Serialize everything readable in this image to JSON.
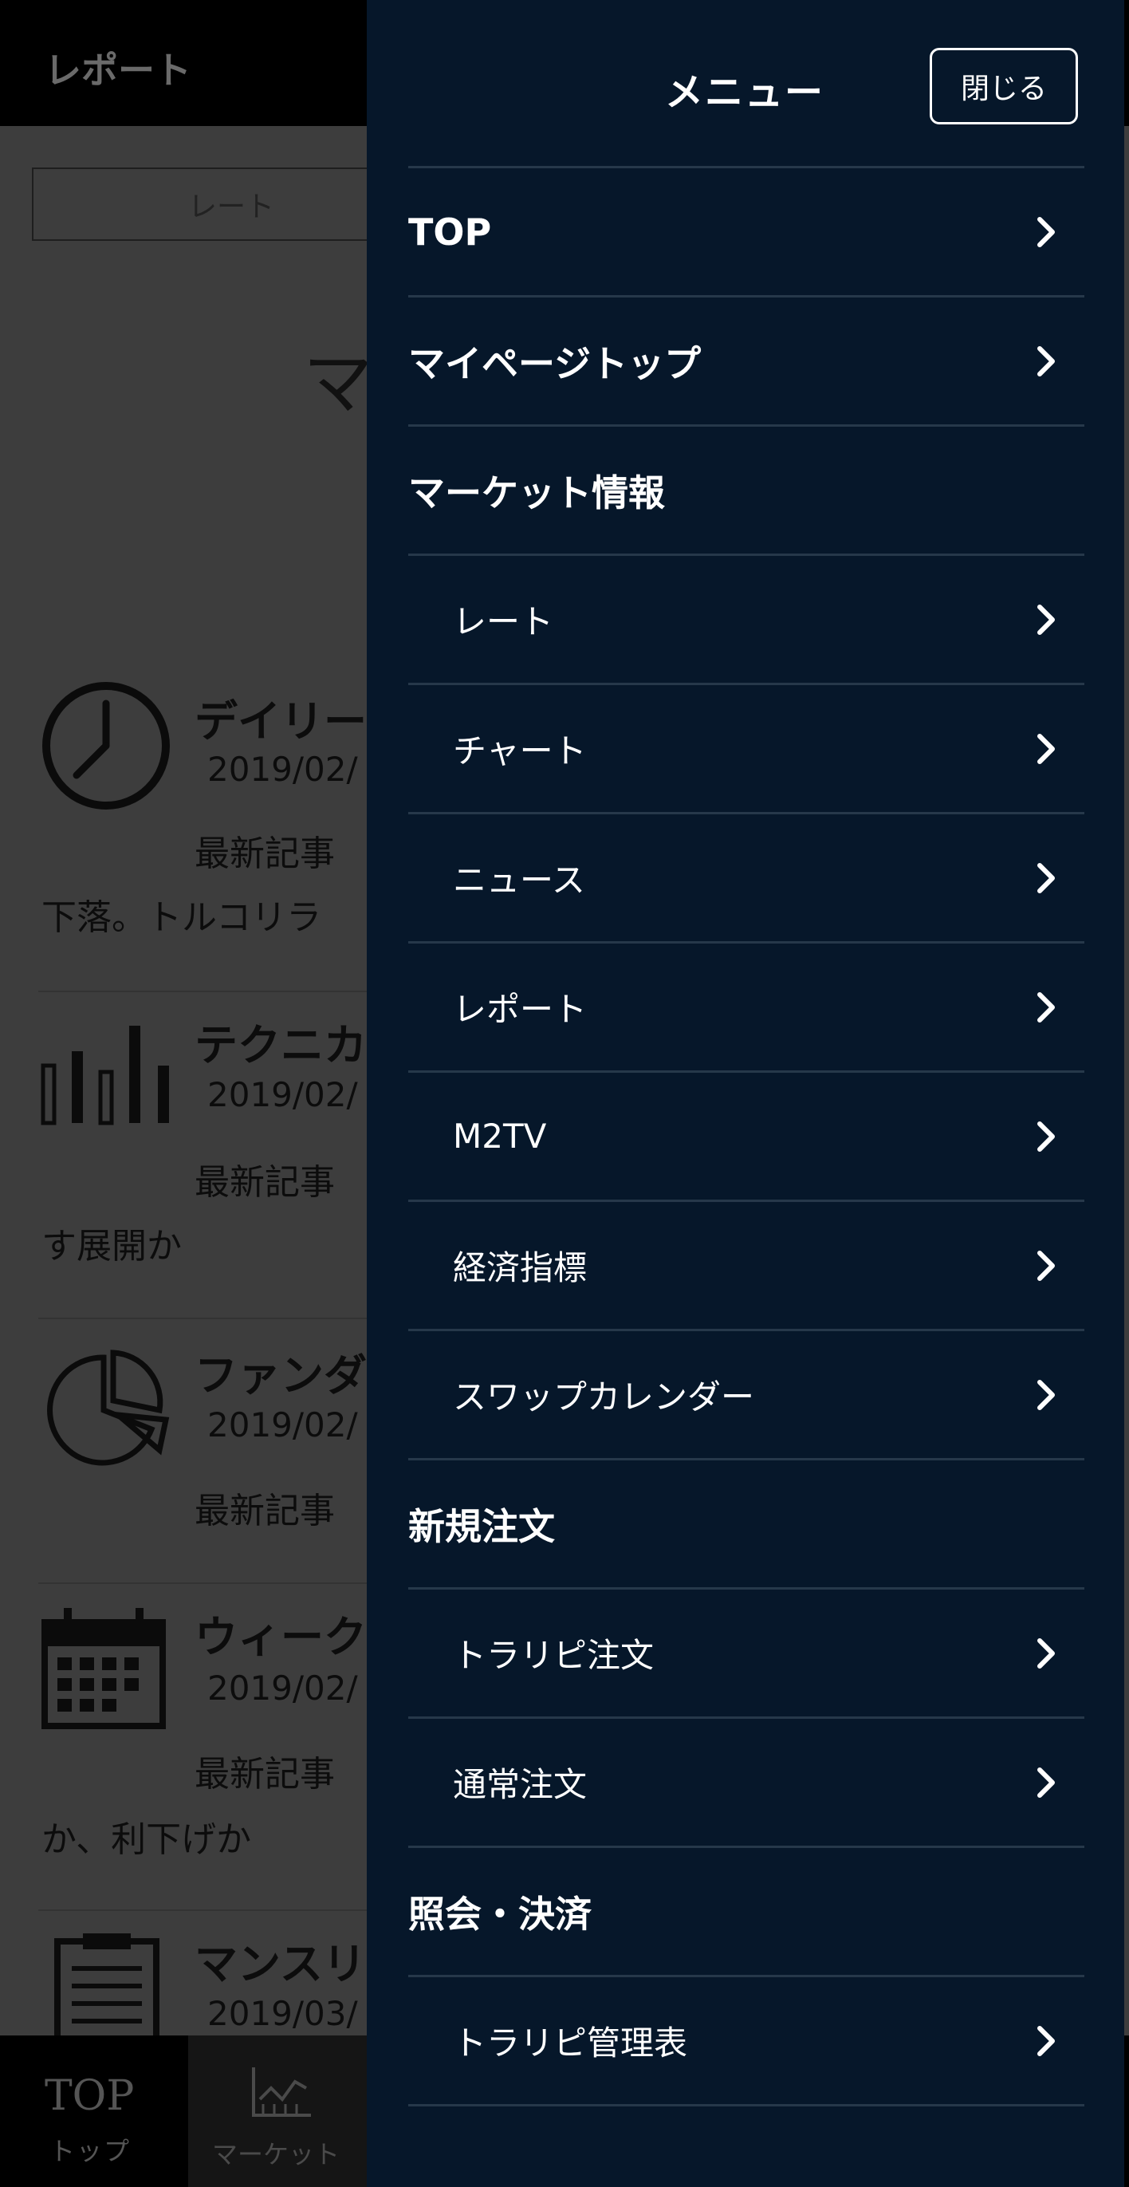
{
  "background_page": {
    "header_title": "レポート",
    "tab_label": "レート",
    "heading_partial": "マ",
    "reports": [
      {
        "name": "デイリー",
        "date": "2019/02/",
        "latest": "最新記事",
        "snippet": "下落。トルコリラ",
        "icon": "clock-icon"
      },
      {
        "name": "テクニカ",
        "date": "2019/02/",
        "latest": "最新記事",
        "snippet": "す展開か",
        "icon": "bar-chart-icon"
      },
      {
        "name": "ファンダ",
        "date": "2019/02/",
        "latest": "最新記事",
        "snippet": "",
        "icon": "pie-chart-icon"
      },
      {
        "name": "ウィーク",
        "date": "2019/02/",
        "latest": "最新記事",
        "snippet": "か、利下げか",
        "icon": "calendar-icon"
      },
      {
        "name": "マンスリ",
        "date": "2019/03/",
        "latest": "",
        "snippet": "",
        "icon": "clipboard-icon"
      }
    ],
    "bottom_nav": {
      "top_main": "TOP",
      "top_sub": "トップ",
      "market_label": "マーケット"
    }
  },
  "drawer": {
    "title": "メニュー",
    "close_label": "閉じる",
    "items": [
      {
        "label": "TOP",
        "type": "section",
        "chevron": true
      },
      {
        "label": "マイページトップ",
        "type": "section",
        "chevron": true
      },
      {
        "label": "マーケット情報",
        "type": "section",
        "chevron": false
      },
      {
        "label": "レート",
        "type": "item",
        "chevron": true
      },
      {
        "label": "チャート",
        "type": "item",
        "chevron": true
      },
      {
        "label": "ニュース",
        "type": "item",
        "chevron": true
      },
      {
        "label": "レポート",
        "type": "item",
        "chevron": true
      },
      {
        "label": "M2TV",
        "type": "item",
        "chevron": true
      },
      {
        "label": "経済指標",
        "type": "item",
        "chevron": true
      },
      {
        "label": "スワップカレンダー",
        "type": "item",
        "chevron": true
      },
      {
        "label": "新規注文",
        "type": "section",
        "chevron": false
      },
      {
        "label": "トラリピ注文",
        "type": "item",
        "chevron": true
      },
      {
        "label": "通常注文",
        "type": "item",
        "chevron": true
      },
      {
        "label": "照会・決済",
        "type": "section",
        "chevron": false
      },
      {
        "label": "トラリピ管理表",
        "type": "item",
        "chevron": true
      }
    ]
  },
  "colors": {
    "drawer_bg": "#06172a",
    "divider": "#26384a",
    "text": "#ffffff"
  }
}
